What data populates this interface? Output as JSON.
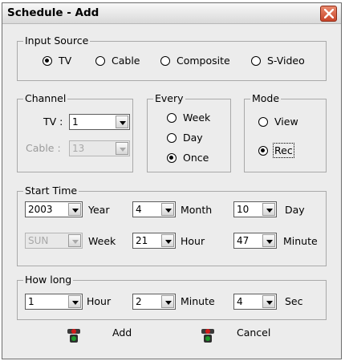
{
  "window": {
    "title": "Schedule - Add"
  },
  "input_source": {
    "legend": "Input Source",
    "options": [
      "TV",
      "Cable",
      "Composite",
      "S-Video"
    ],
    "selected": "TV"
  },
  "channel": {
    "legend": "Channel",
    "tv_label": "TV :",
    "tv_value": "1",
    "cable_label": "Cable :",
    "cable_value": "13"
  },
  "every": {
    "legend": "Every",
    "options": [
      "Week",
      "Day",
      "Once"
    ],
    "selected": "Once"
  },
  "mode": {
    "legend": "Mode",
    "options": [
      "View",
      "Rec"
    ],
    "selected": "Rec"
  },
  "start_time": {
    "legend": "Start Time",
    "year_value": "2003",
    "year_label": "Year",
    "month_value": "4",
    "month_label": "Month",
    "day_value": "10",
    "day_label": "Day",
    "week_value": "SUN",
    "week_label": "Week",
    "hour_value": "21",
    "hour_label": "Hour",
    "minute_value": "47",
    "minute_label": "Minute"
  },
  "how_long": {
    "legend": "How long",
    "hour_value": "1",
    "hour_label": "Hour",
    "minute_value": "2",
    "minute_label": "Minute",
    "sec_value": "4",
    "sec_label": "Sec"
  },
  "buttons": {
    "add_label": "Add",
    "cancel_label": "Cancel"
  },
  "colors": {
    "close_button": "#c9452a",
    "traffic_light_red": "#d21a1a",
    "traffic_light_green": "#1d9a2b"
  },
  "icons": {
    "close": "close-icon",
    "add": "traffic-light-icon",
    "cancel": "traffic-light-icon"
  }
}
